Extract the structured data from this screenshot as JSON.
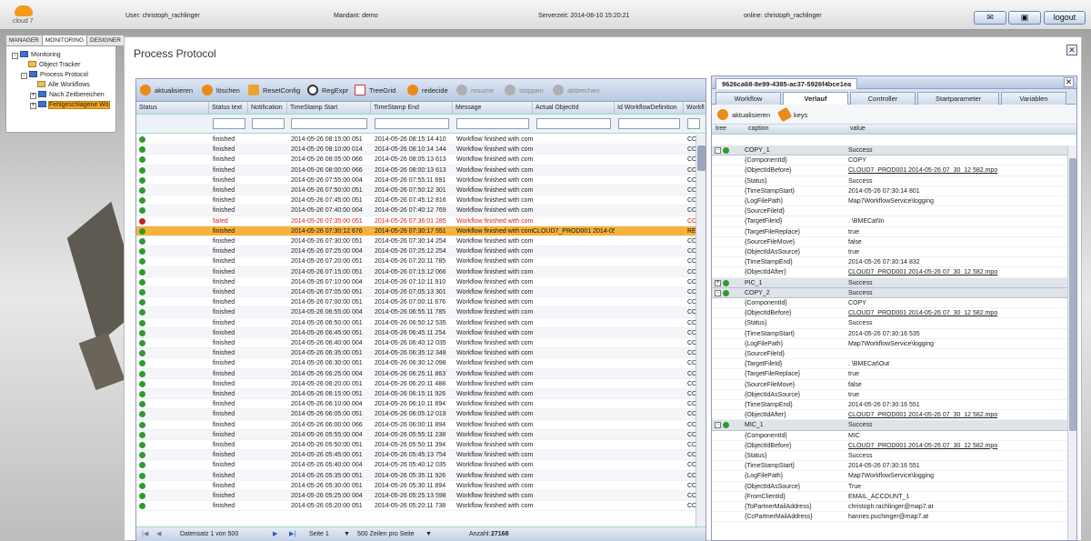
{
  "header": {
    "logo": "cloud 7",
    "user": "User: christoph_rachlinger",
    "mandant": "Mandant: demo",
    "server_time": "Serverzeit: 2014-06-10 15:20:21",
    "online": "online: christoph_rachlinger",
    "logout": "logout",
    "mail_icon": "envelope-icon",
    "window_icon": "window-icon"
  },
  "nav": {
    "tabs": [
      "MANAGER",
      "MONITORING",
      "DESIGNER"
    ],
    "active_tab": "MONITORING",
    "tree": [
      {
        "label": "Monitoring",
        "level": 0,
        "expander": "-"
      },
      {
        "label": "Object Tracker",
        "level": 1,
        "expander": ""
      },
      {
        "label": "Process Protocol",
        "level": 1,
        "expander": "-"
      },
      {
        "label": "Alle Workflows",
        "level": 2,
        "expander": ""
      },
      {
        "label": "Nach Zeitbereichen",
        "level": 2,
        "expander": "+"
      },
      {
        "label": "Fehlgeschlagene Wo",
        "level": 2,
        "expander": "+"
      }
    ]
  },
  "page": {
    "title": "Process Protocol"
  },
  "toolbar": {
    "aktualisieren": "aktualisieren",
    "loeschen": "löschen",
    "resetconfig": "ResetConfig",
    "regexpr": "RegExpr",
    "treegrid": "TreeGrid",
    "redecide": "redecide",
    "resume": "resume",
    "stoppen": "stoppen",
    "abbrechen": "abbrechen"
  },
  "grid": {
    "columns": [
      "Status",
      "Status text",
      "Notification",
      "TimeStamp Start",
      "TimeStamp End",
      "Message",
      "Actual ObjectId",
      "Id WorkflowDefinition",
      "Workfl"
    ],
    "rows": [
      {
        "s": "ok",
        "text": "finished",
        "start": "2014-05-26 08:15:00 051",
        "end": "2014-05-26 08:15:14 410",
        "msg": "Workflow finished with comp",
        "obj": "",
        "wf": "",
        "w": "COI"
      },
      {
        "s": "ok",
        "text": "finished",
        "start": "2014-05-26 08:10:00 014",
        "end": "2014-05-26 08:10:14 144",
        "msg": "Workflow finished with comp",
        "obj": "",
        "wf": "",
        "w": "COI"
      },
      {
        "s": "ok",
        "text": "finished",
        "start": "2014-05-26 08:05:00 066",
        "end": "2014-05-26 08:05:13 613",
        "msg": "Workflow finished with comp",
        "obj": "",
        "wf": "",
        "w": "COI"
      },
      {
        "s": "ok",
        "text": "finished",
        "start": "2014-05-26 08:00:00 066",
        "end": "2014-05-26 08:00:13 613",
        "msg": "Workflow finished with comp",
        "obj": "",
        "wf": "",
        "w": "COI"
      },
      {
        "s": "ok",
        "text": "finished",
        "start": "2014-05-26 07:55:00 004",
        "end": "2014-05-26 07:55:11 691",
        "msg": "Workflow finished with comp",
        "obj": "",
        "wf": "",
        "w": "COI"
      },
      {
        "s": "ok",
        "text": "finished",
        "start": "2014-05-26 07:50:00 051",
        "end": "2014-05-26 07:50:12 301",
        "msg": "Workflow finished with comp",
        "obj": "",
        "wf": "",
        "w": "COI"
      },
      {
        "s": "ok",
        "text": "finished",
        "start": "2014-05-26 07:45:00 051",
        "end": "2014-05-26 07:45:12 816",
        "msg": "Workflow finished with comp",
        "obj": "",
        "wf": "",
        "w": "COI"
      },
      {
        "s": "ok",
        "text": "finished",
        "start": "2014-05-26 07:40:00 004",
        "end": "2014-05-26 07:40:12 769",
        "msg": "Workflow finished with comp",
        "obj": "",
        "wf": "",
        "w": "COI"
      },
      {
        "s": "bad",
        "text": "failed",
        "start": "2014-05-26 07:35:00 051",
        "end": "2014-05-26 07:36:01 285",
        "msg": "Workflow finished with comp",
        "obj": "",
        "wf": "",
        "w": "COI",
        "fail": true
      },
      {
        "s": "ok",
        "text": "finished",
        "start": "2014-05-26 07:30:12 676",
        "end": "2014-05-26 07:30:17 551",
        "msg": "Workflow finished with comp",
        "obj": "CLOUD7_PROD001 2014-05- 1",
        "wf": "",
        "w": "REC",
        "sel": true
      },
      {
        "s": "ok",
        "text": "finished",
        "start": "2014-05-26 07:30:00 051",
        "end": "2014-05-26 07:30:14 254",
        "msg": "Workflow finished with comp",
        "obj": "",
        "wf": "",
        "w": "COI"
      },
      {
        "s": "ok",
        "text": "finished",
        "start": "2014-05-26 07:25:00 004",
        "end": "2014-05-26 07:25:12 254",
        "msg": "Workflow finished with comp",
        "obj": "",
        "wf": "",
        "w": "COI"
      },
      {
        "s": "ok",
        "text": "finished",
        "start": "2014-05-26 07:20:00 051",
        "end": "2014-05-26 07:20:11 785",
        "msg": "Workflow finished with comp",
        "obj": "",
        "wf": "",
        "w": "COI"
      },
      {
        "s": "ok",
        "text": "finished",
        "start": "2014-05-26 07:15:00 051",
        "end": "2014-05-26 07:15:12 066",
        "msg": "Workflow finished with comp",
        "obj": "",
        "wf": "",
        "w": "COI"
      },
      {
        "s": "ok",
        "text": "finished",
        "start": "2014-05-26 07:10:00 004",
        "end": "2014-05-26 07:10:11 910",
        "msg": "Workflow finished with comp",
        "obj": "",
        "wf": "",
        "w": "COI"
      },
      {
        "s": "ok",
        "text": "finished",
        "start": "2014-05-26 07:05:00 051",
        "end": "2014-05-26 07:05:13 301",
        "msg": "Workflow finished with comp",
        "obj": "",
        "wf": "",
        "w": "COI"
      },
      {
        "s": "ok",
        "text": "finished",
        "start": "2014-05-26 07:00:00 051",
        "end": "2014-05-26 07:00:11 676",
        "msg": "Workflow finished with comp",
        "obj": "",
        "wf": "",
        "w": "COI"
      },
      {
        "s": "ok",
        "text": "finished",
        "start": "2014-05-26 06:55:00 004",
        "end": "2014-05-26 06:55:11 785",
        "msg": "Workflow finished with comp",
        "obj": "",
        "wf": "",
        "w": "COI"
      },
      {
        "s": "ok",
        "text": "finished",
        "start": "2014-05-26 06:50:00 051",
        "end": "2014-05-26 06:50:12 535",
        "msg": "Workflow finished with comp",
        "obj": "",
        "wf": "",
        "w": "COI"
      },
      {
        "s": "ok",
        "text": "finished",
        "start": "2014-05-26 06:45:00 051",
        "end": "2014-05-26 06:45:11 254",
        "msg": "Workflow finished with comp",
        "obj": "",
        "wf": "",
        "w": "COI"
      },
      {
        "s": "ok",
        "text": "finished",
        "start": "2014-05-26 06:40:00 004",
        "end": "2014-05-26 06:40:12 035",
        "msg": "Workflow finished with comp",
        "obj": "",
        "wf": "",
        "w": "COI"
      },
      {
        "s": "ok",
        "text": "finished",
        "start": "2014-05-26 06:35:00 051",
        "end": "2014-05-26 06:35:12 348",
        "msg": "Workflow finished with comp",
        "obj": "",
        "wf": "",
        "w": "COI"
      },
      {
        "s": "ok",
        "text": "finished",
        "start": "2014-05-26 06:30:00 051",
        "end": "2014-05-26 06:30:12 098",
        "msg": "Workflow finished with comp",
        "obj": "",
        "wf": "",
        "w": "COI"
      },
      {
        "s": "ok",
        "text": "finished",
        "start": "2014-05-26 06:25:00 004",
        "end": "2014-05-26 06:25:11 863",
        "msg": "Workflow finished with comp",
        "obj": "",
        "wf": "",
        "w": "COI"
      },
      {
        "s": "ok",
        "text": "finished",
        "start": "2014-05-26 06:20:00 051",
        "end": "2014-05-26 06:20:11 488",
        "msg": "Workflow finished with comp",
        "obj": "",
        "wf": "",
        "w": "COI"
      },
      {
        "s": "ok",
        "text": "finished",
        "start": "2014-05-26 06:15:00 051",
        "end": "2014-05-26 06:15:11 926",
        "msg": "Workflow finished with comp",
        "obj": "",
        "wf": "",
        "w": "COI"
      },
      {
        "s": "ok",
        "text": "finished",
        "start": "2014-05-26 06:10:00 004",
        "end": "2014-05-26 06:10:11 894",
        "msg": "Workflow finished with comp",
        "obj": "",
        "wf": "",
        "w": "COI"
      },
      {
        "s": "ok",
        "text": "finished",
        "start": "2014-05-26 06:05:00 051",
        "end": "2014-05-26 06:05:12 019",
        "msg": "Workflow finished with comp",
        "obj": "",
        "wf": "",
        "w": "COI"
      },
      {
        "s": "ok",
        "text": "finished",
        "start": "2014-05-26 06:00:00 066",
        "end": "2014-05-26 06:00:11 894",
        "msg": "Workflow finished with comp",
        "obj": "",
        "wf": "",
        "w": "COI"
      },
      {
        "s": "ok",
        "text": "finished",
        "start": "2014-05-26 05:55:00 004",
        "end": "2014-05-26 05:55:11 238",
        "msg": "Workflow finished with comp",
        "obj": "",
        "wf": "",
        "w": "COI"
      },
      {
        "s": "ok",
        "text": "finished",
        "start": "2014-05-26 05:50:00 051",
        "end": "2014-05-26 05:50:11 394",
        "msg": "Workflow finished with comp",
        "obj": "",
        "wf": "",
        "w": "COI"
      },
      {
        "s": "ok",
        "text": "finished",
        "start": "2014-05-26 05:45:00 051",
        "end": "2014-05-26 05:45:13 754",
        "msg": "Workflow finished with comp",
        "obj": "",
        "wf": "",
        "w": "COI"
      },
      {
        "s": "ok",
        "text": "finished",
        "start": "2014-05-26 05:40:00 004",
        "end": "2014-05-26 05:40:12 035",
        "msg": "Workflow finished with comp",
        "obj": "",
        "wf": "",
        "w": "COI"
      },
      {
        "s": "ok",
        "text": "finished",
        "start": "2014-05-26 05:35:00 051",
        "end": "2014-05-26 05:35:11 926",
        "msg": "Workflow finished with comp",
        "obj": "",
        "wf": "",
        "w": "COI"
      },
      {
        "s": "ok",
        "text": "finished",
        "start": "2014-05-26 05:30:00 051",
        "end": "2014-05-26 05:30:11 894",
        "msg": "Workflow finished with comp",
        "obj": "",
        "wf": "",
        "w": "COI"
      },
      {
        "s": "ok",
        "text": "finished",
        "start": "2014-05-26 05:25:00 004",
        "end": "2014-05-26 05:25:13 598",
        "msg": "Workflow finished with comp",
        "obj": "",
        "wf": "",
        "w": "COI"
      },
      {
        "s": "ok",
        "text": "finished",
        "start": "2014-05-26 05:20:00 051",
        "end": "2014-05-26 05:20:11 738",
        "msg": "Workflow finished with comp",
        "obj": "",
        "wf": "",
        "w": "COI"
      }
    ]
  },
  "pager": {
    "records": "Datensatz 1 von 500",
    "page": "Seite 1",
    "page_size": "500 Zeilen pro Seite",
    "count_label": "Anzahl:",
    "count": "27168"
  },
  "detail": {
    "title": "9626ca68-8e99-4385-ac37-5926f4bce1ea",
    "tabs": [
      "Workflow",
      "Verlauf",
      "Controller",
      "Startparameter",
      "Variablen"
    ],
    "active_tab": "Verlauf",
    "aktualisieren": "aktualisieren",
    "keys": "keys",
    "columns": [
      "tree",
      "caption",
      "value"
    ],
    "rows": [
      {
        "node": true,
        "pm": "-",
        "cap": "COPY_1",
        "val": "Success"
      },
      {
        "cap": "{ComponentId}",
        "val": "COPY"
      },
      {
        "cap": "{ObjectIdBefore}",
        "val": "CLOUD7_PROD001 2014-05-26 07_30_12 582.mpo",
        "lnk": true
      },
      {
        "cap": "{Status}",
        "val": "Success"
      },
      {
        "cap": "{TimeStampStart}",
        "val": "2014-05-26 07:30:14 801"
      },
      {
        "cap": "{LogFilePath}",
        "val": "Map7WorkflowService\\logging"
      },
      {
        "cap": "{SourceFileId}",
        "val": ""
      },
      {
        "cap": "{TargetFileId}",
        "val": ". \\BMECat\\In"
      },
      {
        "cap": "{TargetFileReplace}",
        "val": "true"
      },
      {
        "cap": "{SourceFileMove}",
        "val": "false"
      },
      {
        "cap": "{ObjectIdAsSource}",
        "val": "true"
      },
      {
        "cap": "{TimeStampEnd}",
        "val": "2014-05-26 07:30:14 832"
      },
      {
        "cap": "{ObjectIdAfter}",
        "val": "CLOUD7_PROD001 2014-05-26 07_30_12 582.mpo",
        "lnk": true
      },
      {
        "node": true,
        "pm": "+",
        "cap": "PIC_1",
        "val": "Success"
      },
      {
        "node": true,
        "pm": "-",
        "cap": "COPY_2",
        "val": "Success"
      },
      {
        "cap": "{ComponentId}",
        "val": "COPY"
      },
      {
        "cap": "{ObjectIdBefore}",
        "val": "CLOUD7_PROD001 2014-05-26 07_30_12 582.mpo",
        "lnk": true
      },
      {
        "cap": "{Status}",
        "val": "Success"
      },
      {
        "cap": "{TimeStampStart}",
        "val": "2014-05-26 07:30:16 535"
      },
      {
        "cap": "{LogFilePath}",
        "val": "Map7WorkflowService\\logging"
      },
      {
        "cap": "{SourceFileId}",
        "val": ""
      },
      {
        "cap": "{TargetFileId}",
        "val": ". \\BMECat\\Out"
      },
      {
        "cap": "{TargetFileReplace}",
        "val": "true"
      },
      {
        "cap": "{SourceFileMove}",
        "val": "false"
      },
      {
        "cap": "{ObjectIdAsSource}",
        "val": "true"
      },
      {
        "cap": "{TimeStampEnd}",
        "val": "2014-05-26 07:30:16 551"
      },
      {
        "cap": "{ObjectIdAfter}",
        "val": "CLOUD7_PROD001 2014-05-26 07_30_12 582.mpo",
        "lnk": true
      },
      {
        "node": true,
        "pm": "-",
        "cap": "MIC_1",
        "val": "Success"
      },
      {
        "cap": "{ComponentId}",
        "val": "MIC"
      },
      {
        "cap": "{ObjectIdBefore}",
        "val": "CLOUD7_PROD001 2014-05-26 07_30_12 582.mpo",
        "lnk": true
      },
      {
        "cap": "{Status}",
        "val": "Success"
      },
      {
        "cap": "{TimeStampStart}",
        "val": "2014-05-26 07:30:16 551"
      },
      {
        "cap": "{LogFilePath}",
        "val": "Map7WorkflowService\\logging"
      },
      {
        "cap": "{ObjectIdAsSource}",
        "val": "True"
      },
      {
        "cap": "{FromClientId}",
        "val": "EMAIL_ACCOUNT_1"
      },
      {
        "cap": "{ToPartnerMailAddress}",
        "val": "christoph.rachlinger@map7.at"
      },
      {
        "cap": "{CcPartnerMailAddress}",
        "val": "hannes.puchinger@map7.at"
      }
    ]
  }
}
